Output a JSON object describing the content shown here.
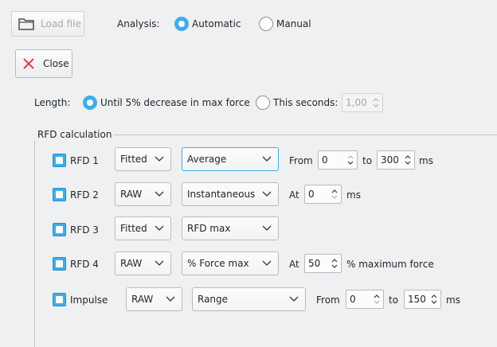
{
  "toolbar": {
    "load_file_label": "Load file",
    "analysis_label": "Analysis:",
    "automatic_label": "Automatic",
    "manual_label": "Manual",
    "close_label": "Close"
  },
  "length": {
    "label": "Length:",
    "option_until_label": "Until 5% decrease in max force",
    "option_seconds_label": "This seconds:",
    "seconds_value": "1,00"
  },
  "rfd": {
    "group_title": "RFD calculation",
    "rows": [
      {
        "name": "RFD 1",
        "type": "Fitted",
        "method": "Average",
        "pre": "From",
        "v1": "0",
        "mid": "to",
        "v2": "300",
        "unit": "ms"
      },
      {
        "name": "RFD 2",
        "type": "RAW",
        "method": "Instantaneous",
        "pre": "At",
        "v1": "0",
        "unit": "ms"
      },
      {
        "name": "RFD 3",
        "type": "Fitted",
        "method": "RFD max"
      },
      {
        "name": "RFD 4",
        "type": "RAW",
        "method": "% Force max",
        "pre": "At",
        "v1": "50",
        "unit": "% maximum force"
      },
      {
        "name": "Impulse",
        "type": "RAW",
        "method": "Range",
        "pre": "From",
        "v1": "0",
        "mid": "to",
        "v2": "150",
        "unit": "ms"
      }
    ]
  },
  "colors": {
    "accent": "#3daee9",
    "close_icon": "#da4453",
    "background": "#eff0f1"
  },
  "icons": {
    "load_file": "folder-icon",
    "close": "close-x-icon"
  }
}
